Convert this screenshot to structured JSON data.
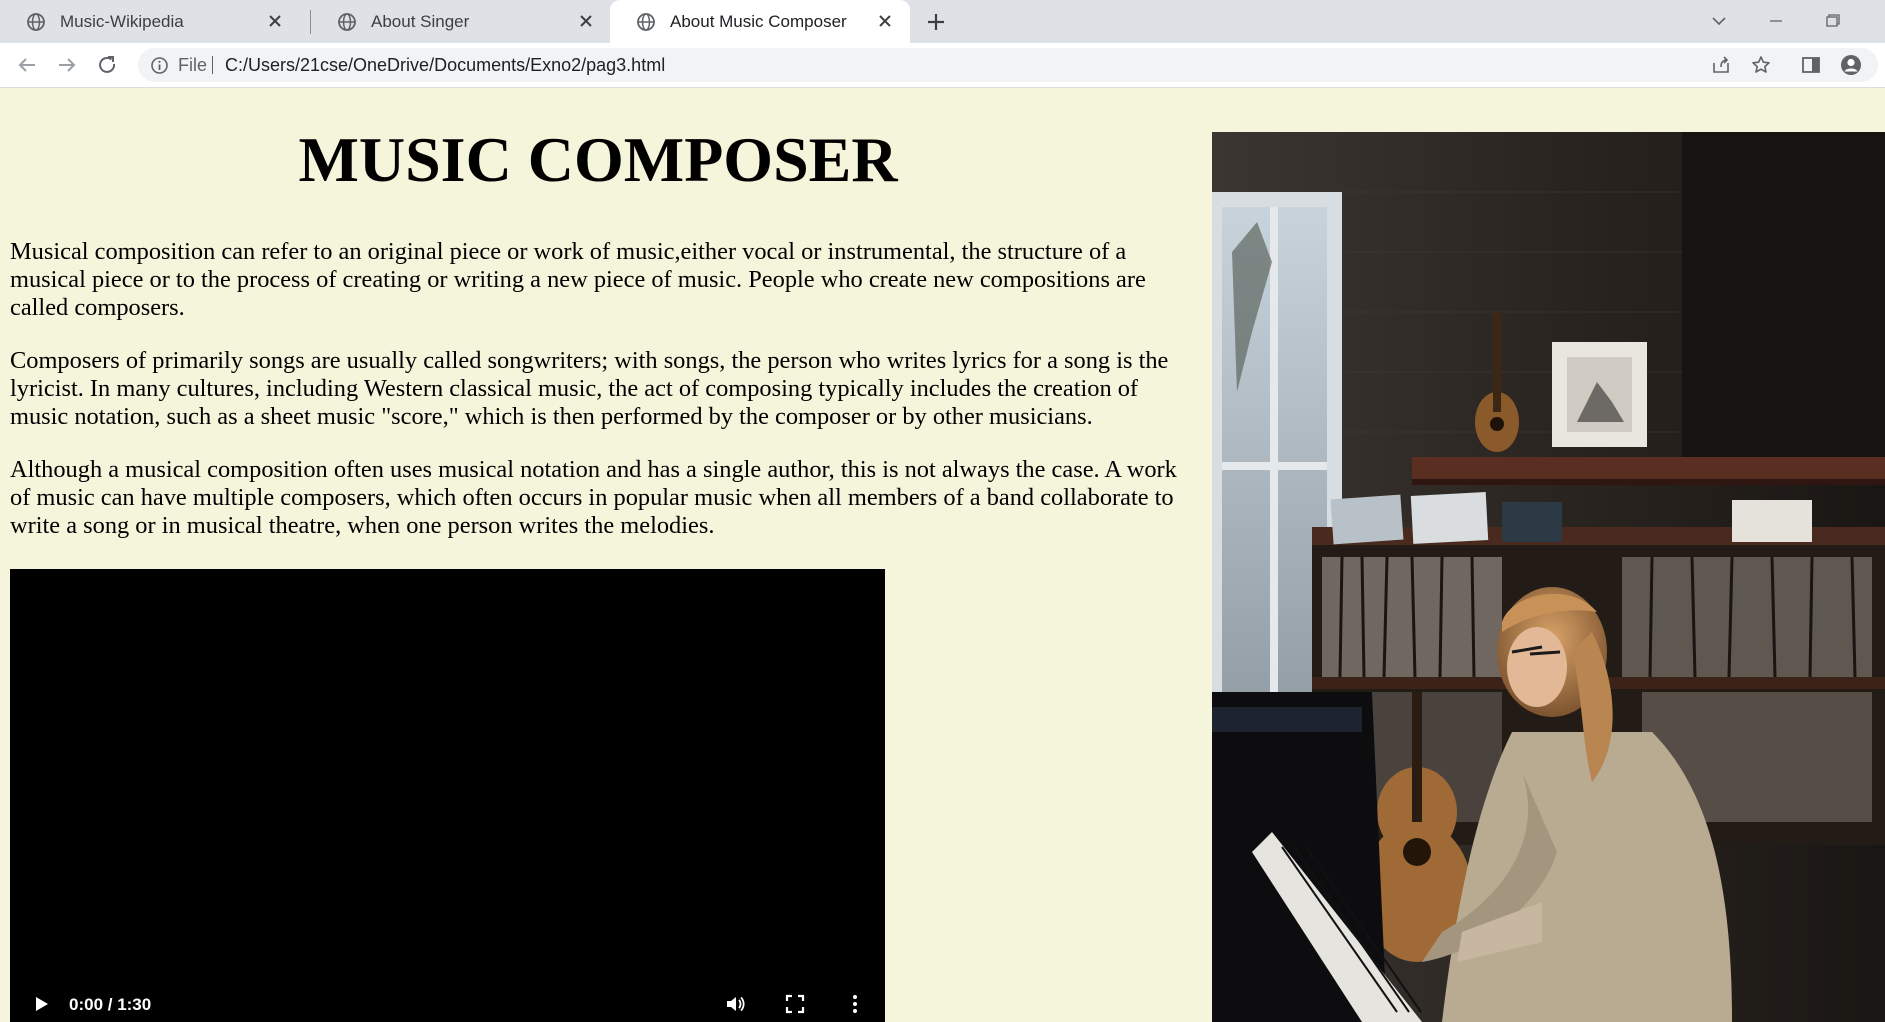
{
  "browser": {
    "tabs": [
      {
        "title": "Music-Wikipedia",
        "active": false
      },
      {
        "title": "About Singer",
        "active": false
      },
      {
        "title": "About Music Composer",
        "active": true
      }
    ],
    "address": {
      "scheme": "File",
      "url": "C:/Users/21cse/OneDrive/Documents/Exno2/pag3.html"
    }
  },
  "page": {
    "heading": "MUSIC COMPOSER",
    "paragraphs": [
      "Musical composition can refer to an original piece or work of music,either vocal or instrumental, the structure of a musical piece or to the process of creating or writing a new piece of music. People who create new compositions are called composers.",
      "Composers of primarily songs are usually called songwriters; with songs, the person who writes lyrics for a song is the lyricist. In many cultures, including Western classical music, the act of composing typically includes the creation of music notation, such as a sheet music \"score,\" which is then performed by the composer or by other musicians.",
      "Although a musical composition often uses musical notation and has a single author, this is not always the case. A work of music can have multiple composers, which often occurs in popular music when all members of a band collaborate to write a song or in musical theatre, when one person writes the melodies."
    ],
    "video": {
      "time": "0:00 / 1:30"
    }
  },
  "colors": {
    "page_background": "#f5f5dc",
    "tabstrip": "#dee1e6",
    "video_background": "#000000"
  }
}
